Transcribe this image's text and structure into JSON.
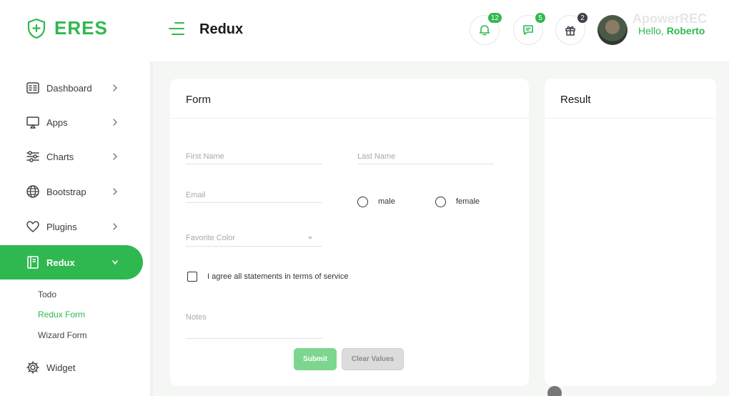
{
  "brand": {
    "name": "ERES",
    "accent": "#2fb84f"
  },
  "header": {
    "title": "Redux",
    "notifications_count": "12",
    "messages_count": "5",
    "gifts_count": "2",
    "greeting_prefix": "Hello,",
    "user_name": "Roberto",
    "watermark": "ApowerREC",
    "badge_colors": {
      "notifications": "#2fb84f",
      "messages": "#2fb84f",
      "gifts": "#3b3f4a"
    }
  },
  "sidebar": {
    "items": [
      {
        "label": "Dashboard",
        "icon": "dashboard-icon"
      },
      {
        "label": "Apps",
        "icon": "monitor-icon"
      },
      {
        "label": "Charts",
        "icon": "sliders-icon"
      },
      {
        "label": "Bootstrap",
        "icon": "globe-icon"
      },
      {
        "label": "Plugins",
        "icon": "heart-icon"
      },
      {
        "label": "Redux",
        "icon": "book-icon",
        "active": true
      },
      {
        "label": "Widget",
        "icon": "gear-icon"
      }
    ],
    "sub_items": [
      {
        "label": "Todo"
      },
      {
        "label": "Redux Form",
        "active": true
      },
      {
        "label": "Wizard Form"
      }
    ]
  },
  "form_card": {
    "title": "Form",
    "first_name_placeholder": "First Name",
    "last_name_placeholder": "Last Name",
    "email_placeholder": "Email",
    "gender_options": [
      "male",
      "female"
    ],
    "favorite_color_placeholder": "Favorite Color",
    "agree_label": "I agree all statements in terms of service",
    "notes_placeholder": "Notes",
    "submit_label": "Submit",
    "clear_label": "Clear Values"
  },
  "result_card": {
    "title": "Result"
  }
}
